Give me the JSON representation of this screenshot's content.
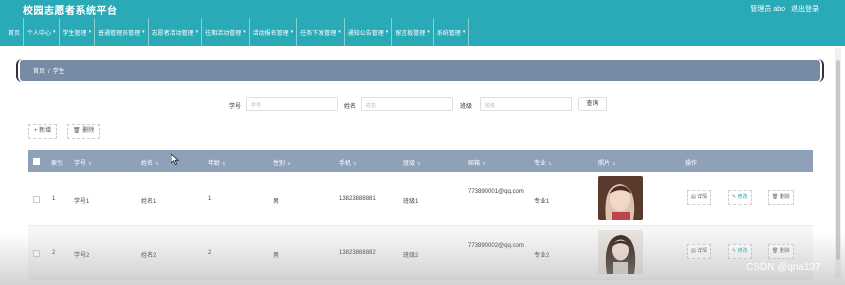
{
  "header": {
    "title": "校园志愿者系统平台",
    "user": "管理员 abo",
    "logout": "退出登录"
  },
  "nav": [
    {
      "label": "首页",
      "dropdown": false
    },
    {
      "label": "个人中心",
      "dropdown": true
    },
    {
      "label": "学生管理",
      "dropdown": true
    },
    {
      "label": "普通管理员管理",
      "dropdown": true
    },
    {
      "label": "志愿者活动管理",
      "dropdown": true
    },
    {
      "label": "往期活动管理",
      "dropdown": true
    },
    {
      "label": "活动报名管理",
      "dropdown": true
    },
    {
      "label": "任务下发管理",
      "dropdown": true
    },
    {
      "label": "通知公告管理",
      "dropdown": true
    },
    {
      "label": "留言板管理",
      "dropdown": true
    },
    {
      "label": "系统管理",
      "dropdown": true
    }
  ],
  "breadcrumb": {
    "home": "首页",
    "separator": "/",
    "current": "学生"
  },
  "search": {
    "student_no_label": "学号",
    "student_no_placeholder": "学号",
    "name_label": "姓名",
    "name_placeholder": "姓名",
    "class_label": "班级",
    "class_placeholder": "班级",
    "button": "查询"
  },
  "actions": {
    "add": "+ 新增",
    "delete": "删除"
  },
  "table": {
    "headers": [
      "索引",
      "学号",
      "姓名",
      "年龄",
      "性别",
      "手机",
      "班级",
      "邮箱",
      "专业",
      "照片",
      "操作"
    ],
    "rows": [
      {
        "index": "1",
        "student_no": "学号1",
        "name": "姓名1",
        "age": "1",
        "gender": "男",
        "phone": "13823888881",
        "class": "班级1",
        "email": "773890001@qq.com",
        "major": "专业1"
      },
      {
        "index": "2",
        "student_no": "学号2",
        "name": "姓名2",
        "age": "2",
        "gender": "男",
        "phone": "13823888882",
        "class": "班级2",
        "email": "773890002@qq.com",
        "major": "专业2"
      }
    ],
    "row_actions": {
      "detail": "详情",
      "edit": "修改",
      "delete": "删除"
    }
  },
  "watermark": "CSDN @qna137",
  "colors": {
    "primary": "#2aa9b6",
    "breadcrumb_bg": "#778ca4",
    "table_header_bg": "#8ea1b8"
  }
}
